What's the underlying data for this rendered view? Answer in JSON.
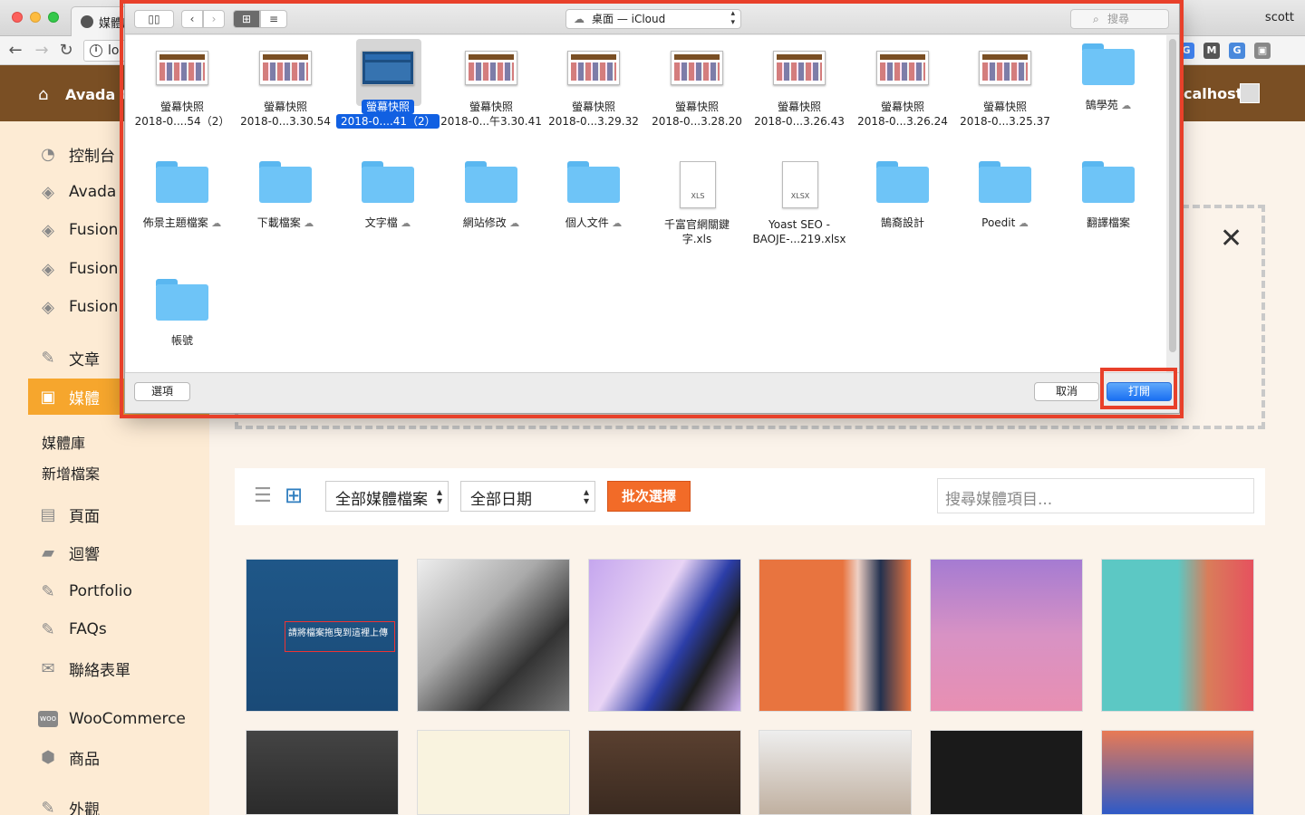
{
  "browser": {
    "tab_title": "媒體庫",
    "address": "lo",
    "user": "scott"
  },
  "wp": {
    "site_name": "Avada C",
    "howdy": "calhost",
    "menu": [
      {
        "label": "控制台",
        "icon": "dashboard-icon"
      },
      {
        "label": "Avada",
        "icon": "avada-icon"
      },
      {
        "label": "Fusion",
        "icon": "fusion-icon"
      },
      {
        "label": "Fusion",
        "icon": "fusion-icon"
      },
      {
        "label": "Fusion",
        "icon": "fusion-icon"
      },
      {
        "label": "文章",
        "icon": "pin-icon"
      },
      {
        "label": "媒體",
        "icon": "media-icon"
      },
      {
        "label": "頁面",
        "icon": "page-icon"
      },
      {
        "label": "迴響",
        "icon": "comment-icon"
      },
      {
        "label": "Portfolio",
        "icon": "pin-icon"
      },
      {
        "label": "FAQs",
        "icon": "pin-icon"
      },
      {
        "label": "聯絡表單",
        "icon": "mail-icon"
      },
      {
        "label": "WooCommerce",
        "icon": "woo-icon"
      },
      {
        "label": "商品",
        "icon": "product-icon"
      },
      {
        "label": "外觀",
        "icon": "brush-icon"
      }
    ],
    "submenu": [
      "媒體庫",
      "新增檔案"
    ],
    "media": {
      "filter_type": "全部媒體檔案",
      "filter_date": "全部日期",
      "bulk_select": "批次選擇",
      "search_placeholder": "搜尋媒體項目...",
      "thumb_caption": "請將檔案拖曳到這裡上傳"
    }
  },
  "dialog": {
    "location": "桌面 — iCloud",
    "search_placeholder": "搜尋",
    "options_button": "選項",
    "cancel_button": "取消",
    "open_button": "打開",
    "files": [
      {
        "name": "螢幕快照",
        "sub": "2018-0....54（2）",
        "kind": "screenshot",
        "cloud": false
      },
      {
        "name": "螢幕快照",
        "sub": "2018-0...3.30.54",
        "kind": "screenshot",
        "cloud": false
      },
      {
        "name": "螢幕快照",
        "sub": "2018-0....41（2）",
        "kind": "screenshot-blue",
        "cloud": false,
        "selected": true
      },
      {
        "name": "螢幕快照",
        "sub": "2018-0...午3.30.41",
        "kind": "screenshot",
        "cloud": false
      },
      {
        "name": "螢幕快照",
        "sub": "2018-0...3.29.32",
        "kind": "screenshot",
        "cloud": false
      },
      {
        "name": "螢幕快照",
        "sub": "2018-0...3.28.20",
        "kind": "screenshot",
        "cloud": false
      },
      {
        "name": "螢幕快照",
        "sub": "2018-0...3.26.43",
        "kind": "screenshot",
        "cloud": false
      },
      {
        "name": "螢幕快照",
        "sub": "2018-0...3.26.24",
        "kind": "screenshot",
        "cloud": false
      },
      {
        "name": "螢幕快照",
        "sub": "2018-0...3.25.37",
        "kind": "screenshot",
        "cloud": false
      },
      {
        "name": "鵠學苑",
        "sub": "",
        "kind": "folder",
        "cloud": true
      },
      {
        "name": "佈景主題檔案",
        "sub": "",
        "kind": "folder",
        "cloud": true
      },
      {
        "name": "下載檔案",
        "sub": "",
        "kind": "folder",
        "cloud": true
      },
      {
        "name": "文字檔",
        "sub": "",
        "kind": "folder",
        "cloud": true
      },
      {
        "name": "網站修改",
        "sub": "",
        "kind": "folder",
        "cloud": true
      },
      {
        "name": "個人文件",
        "sub": "",
        "kind": "folder",
        "cloud": true
      },
      {
        "name": "千富官網關鍵",
        "sub": "字.xls",
        "kind": "xls",
        "cloud": false
      },
      {
        "name": "Yoast SEO -",
        "sub": "BAOJE-...219.xlsx",
        "kind": "xlsx",
        "cloud": false
      },
      {
        "name": "鵠裔設計",
        "sub": "",
        "kind": "folder",
        "cloud": false
      },
      {
        "name": "Poedit",
        "sub": "",
        "kind": "folder",
        "cloud": true
      },
      {
        "name": "翻譯檔案",
        "sub": "",
        "kind": "folder",
        "cloud": false
      },
      {
        "name": "帳號",
        "sub": "",
        "kind": "folder",
        "cloud": false
      }
    ]
  },
  "colors": {
    "wp_adminbar": "#7a4f24",
    "wp_sidebar": "#fdebd4",
    "wp_active": "#f6a62d",
    "bulk_button": "#f26b28",
    "highlight": "#e8402a",
    "mac_blue": "#1160e2"
  }
}
